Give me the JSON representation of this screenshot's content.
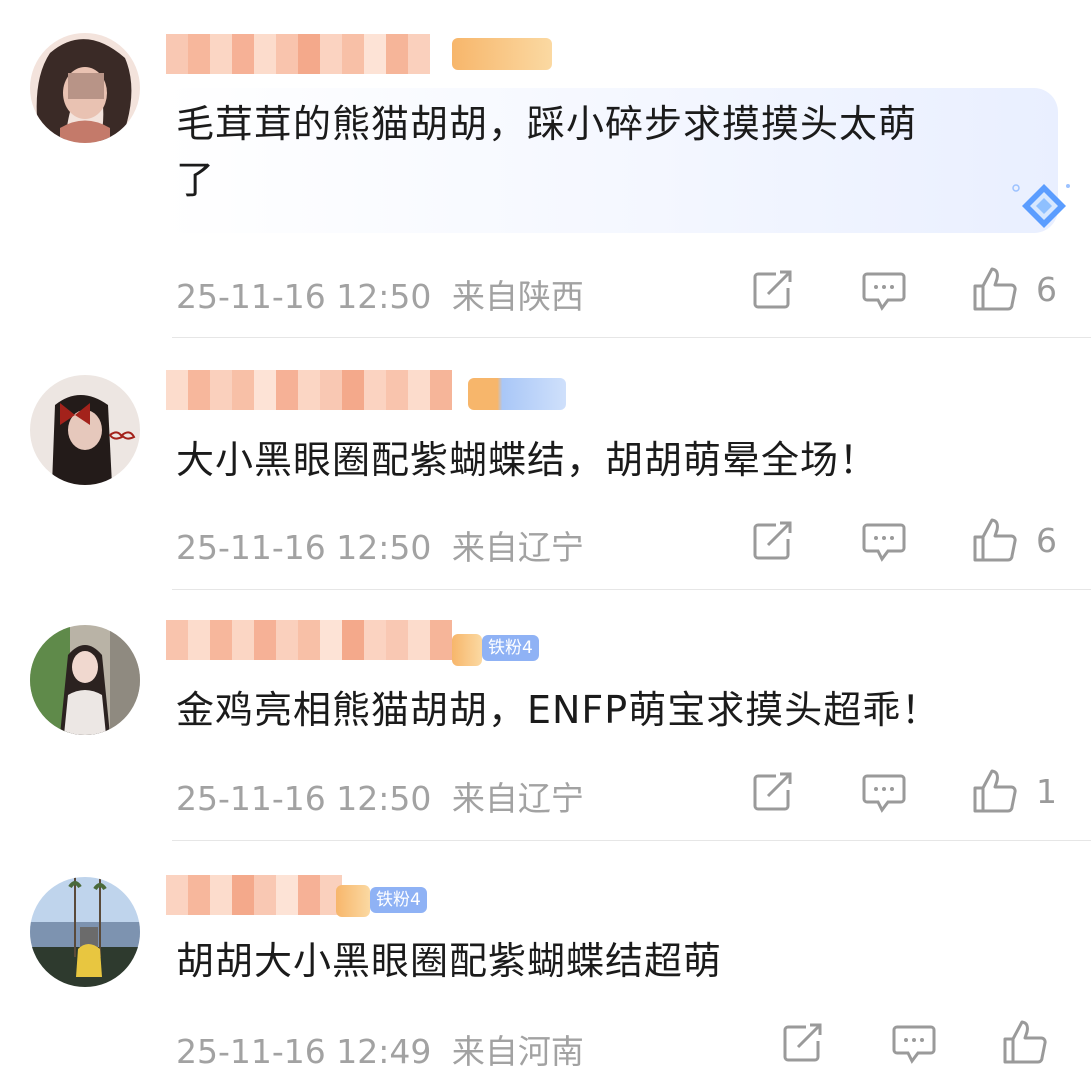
{
  "comments": [
    {
      "text": "毛茸茸的熊猫胡胡，踩小碎步求摸摸头太萌了",
      "text_line1": "毛茸茸的熊猫胡胡，踩小碎步求摸摸头太萌",
      "text_line2": "了",
      "timestamp": "25-11-16 12:50",
      "location": "来自陕西",
      "likes": "6",
      "badge": ""
    },
    {
      "text": "大小黑眼圈配紫蝴蝶结，胡胡萌晕全场！",
      "timestamp": "25-11-16 12:50",
      "location": "来自辽宁",
      "likes": "6",
      "badge": ""
    },
    {
      "text": "金鸡亮相熊猫胡胡，ENFP萌宝求摸头超乖！",
      "timestamp": "25-11-16 12:50",
      "location": "来自辽宁",
      "likes": "1",
      "badge": "铁粉4"
    },
    {
      "text": "胡胡大小黑眼圈配紫蝴蝶结超萌",
      "timestamp": "25-11-16 12:49",
      "location": "来自河南",
      "likes": "",
      "badge": "铁粉4"
    }
  ],
  "icons": {
    "repost": "share-square-icon",
    "reply": "comment-bubble-icon",
    "like": "thumbs-up-icon",
    "bubble_decoration": "diamond-icon"
  },
  "colors": {
    "meta_text": "#a2a2a2",
    "badge_blue": "#8fb2f5",
    "divider": "#e6e6e6"
  }
}
